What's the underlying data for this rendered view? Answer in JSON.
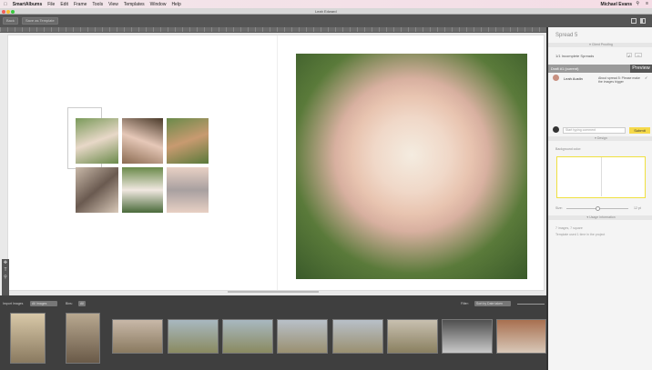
{
  "menubar": {
    "app": "SmartAlbums",
    "items": [
      "File",
      "Edit",
      "Frame",
      "Tools",
      "View",
      "Templates",
      "Window",
      "Help"
    ],
    "user": "Michael Evans"
  },
  "window": {
    "title": "Leah Edward"
  },
  "toolbar": {
    "back": "Back",
    "save_template": "Save as Template"
  },
  "panel": {
    "title": "Spread 5",
    "client_proofing": "Client Proofing",
    "incomplete": "1/1 Incomplete Spreads",
    "draft": "Draft #1 (current)",
    "preview": "Preview",
    "comment": {
      "author": "Leah Austin",
      "text": "About spread 5: Please make the images bigger"
    },
    "comment_placeholder": "Start typing comment",
    "submit": "Submit",
    "design": "Design",
    "background_color": "Background color:",
    "size_label": "Size:",
    "size_value": "12 pt",
    "size_fraction": 0.5,
    "usage_information": "Usage Information",
    "usage_line1": "7 images, 7 square",
    "usage_line2": "Template used 1 time in the project"
  },
  "bottom": {
    "import": "Import Images",
    "images_select": "All Images",
    "bins": "Bins:",
    "bins_value": "All",
    "filter": "Filter:",
    "filter_value": "Sort by Date taken"
  },
  "colors": {
    "accent": "#f5d94a",
    "panel_header": "#9a9a9a"
  }
}
